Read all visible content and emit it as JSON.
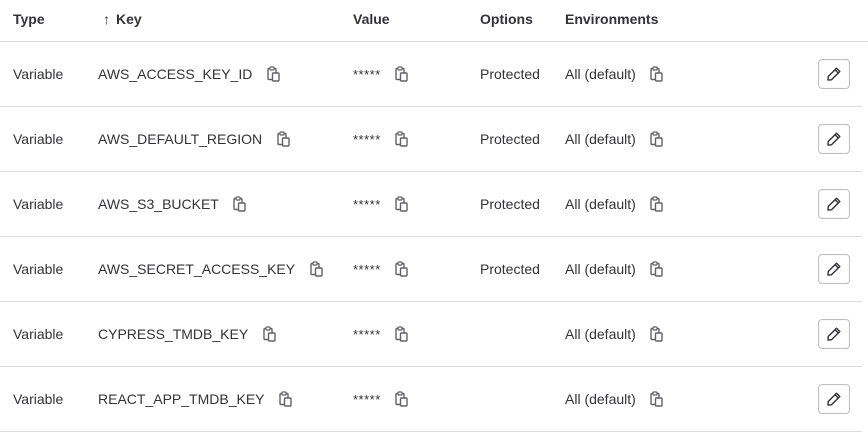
{
  "header": {
    "type_label": "Type",
    "key_label": "Key",
    "key_sort_icon": "arrow-up-icon",
    "key_sort_glyph": "↑",
    "value_label": "Value",
    "options_label": "Options",
    "environments_label": "Environments"
  },
  "rows": [
    {
      "type": "Variable",
      "key": "AWS_ACCESS_KEY_ID",
      "value": "*****",
      "options": "Protected",
      "environment": "All (default)"
    },
    {
      "type": "Variable",
      "key": "AWS_DEFAULT_REGION",
      "value": "*****",
      "options": "Protected",
      "environment": "All (default)"
    },
    {
      "type": "Variable",
      "key": "AWS_S3_BUCKET",
      "value": "*****",
      "options": "Protected",
      "environment": "All (default)"
    },
    {
      "type": "Variable",
      "key": "AWS_SECRET_ACCESS_KEY",
      "value": "*****",
      "options": "Protected",
      "environment": "All (default)"
    },
    {
      "type": "Variable",
      "key": "CYPRESS_TMDB_KEY",
      "value": "*****",
      "options": "",
      "environment": "All (default)"
    },
    {
      "type": "Variable",
      "key": "REACT_APP_TMDB_KEY",
      "value": "*****",
      "options": "",
      "environment": "All (default)"
    }
  ],
  "icons": {
    "copy": "clipboard-copy-icon",
    "edit": "pencil-icon"
  },
  "colors": {
    "text": "#333238",
    "border": "#dcdcde",
    "icon": "#626168"
  }
}
